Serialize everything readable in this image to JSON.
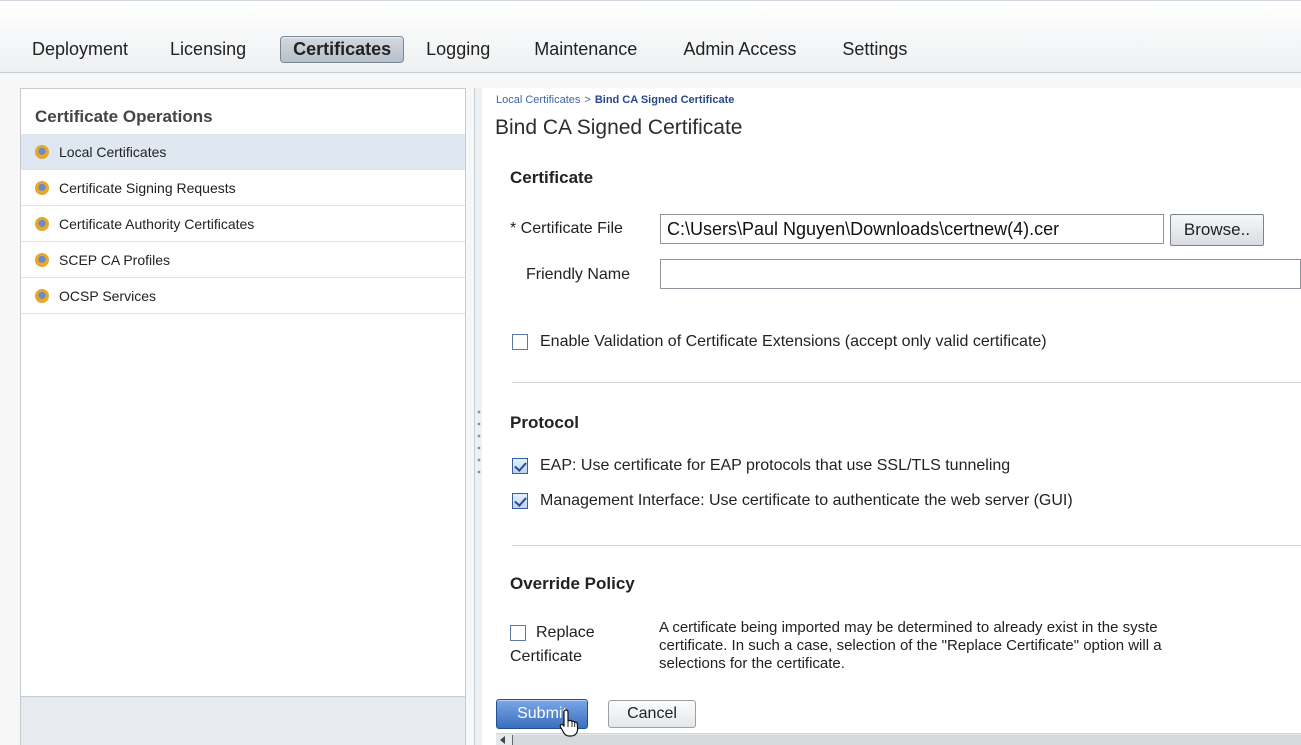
{
  "nav": {
    "tabs": [
      {
        "label": "Deployment"
      },
      {
        "label": "Licensing"
      },
      {
        "label": "Certificates",
        "active": true
      },
      {
        "label": "Logging"
      },
      {
        "label": "Maintenance"
      },
      {
        "label": "Admin Access"
      },
      {
        "label": "Settings"
      }
    ]
  },
  "sidebar": {
    "title": "Certificate Operations",
    "items": [
      {
        "label": "Local Certificates",
        "active": true
      },
      {
        "label": "Certificate Signing Requests"
      },
      {
        "label": "Certificate Authority Certificates"
      },
      {
        "label": "SCEP CA Profiles"
      },
      {
        "label": "OCSP Services"
      }
    ]
  },
  "breadcrumb": {
    "parent": "Local Certificates",
    "separator": ">",
    "current": "Bind CA Signed Certificate"
  },
  "page": {
    "title": "Bind CA Signed Certificate"
  },
  "certificate": {
    "heading": "Certificate",
    "file_label": "* Certificate File",
    "file_value": "C:\\Users\\Paul Nguyen\\Downloads\\certnew(4).cer",
    "browse_label": "Browse..",
    "friendly_label": "Friendly Name",
    "friendly_value": "",
    "validation_label": "Enable Validation of Certificate Extensions (accept only valid certificate)",
    "validation_checked": false
  },
  "protocol": {
    "heading": "Protocol",
    "eap_label": "EAP: Use certificate for EAP protocols that use SSL/TLS tunneling",
    "eap_checked": true,
    "mgmt_label": "Management Interface: Use certificate to authenticate the web server (GUI)",
    "mgmt_checked": true
  },
  "override": {
    "heading": "Override Policy",
    "replace_label_line1": "Replace",
    "replace_label_line2": "Certificate",
    "replace_checked": false,
    "desc_line1": "A certificate being imported may be determined to already exist in the syste",
    "desc_line2": "certificate. In such a case, selection of the \"Replace Certificate\" option will a",
    "desc_line3": "selections for the certificate."
  },
  "actions": {
    "submit_label": "Submit",
    "cancel_label": "Cancel"
  },
  "colors": {
    "accent": "#3b6fbd",
    "link": "#3d64a8",
    "selected_row": "#dfe7f0"
  }
}
